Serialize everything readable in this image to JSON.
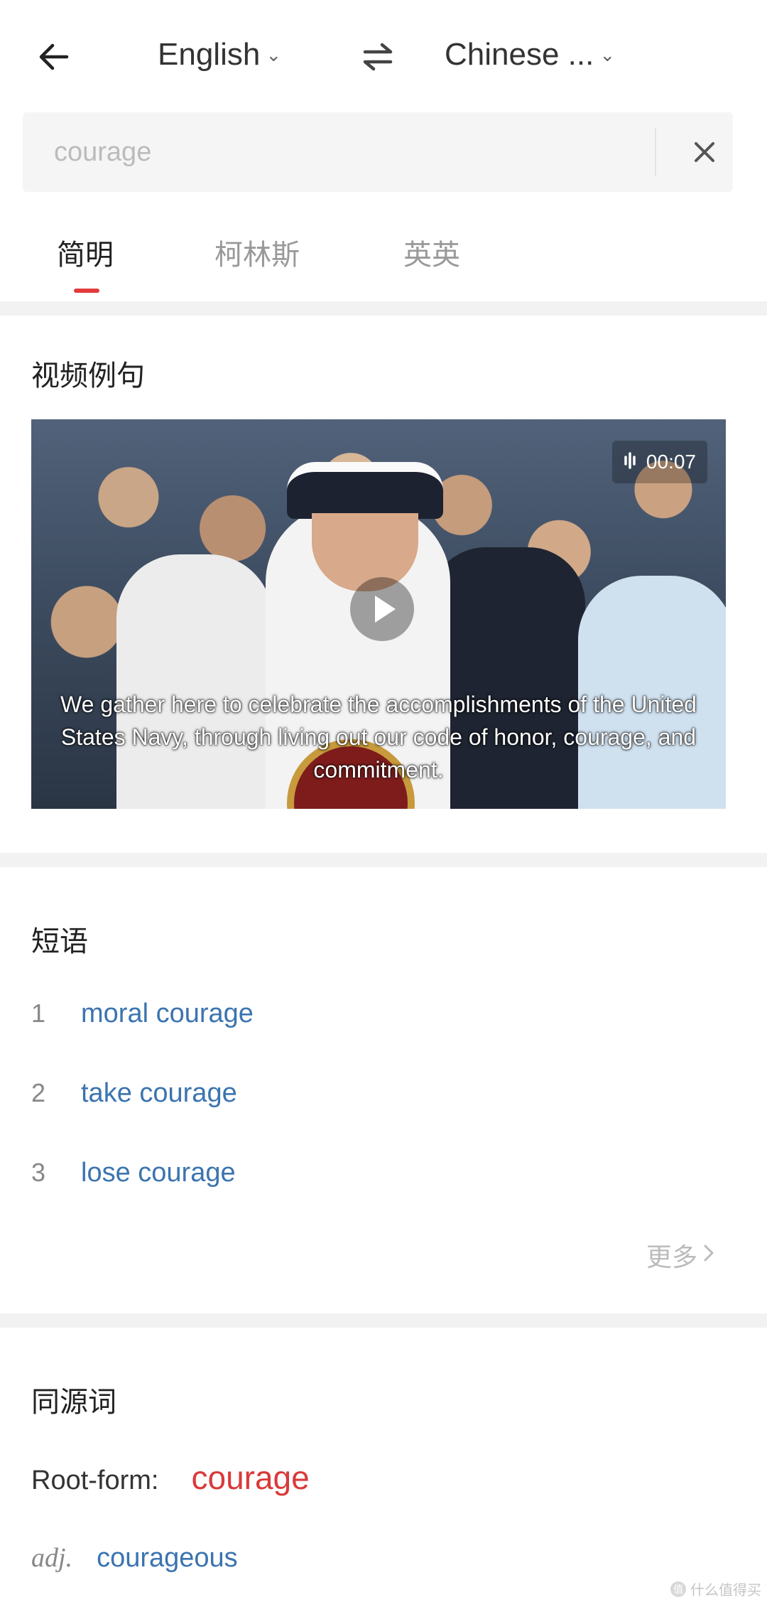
{
  "header": {
    "source_language": "English",
    "target_language": "Chinese ...",
    "colors": {
      "accent": "#e23b3b"
    }
  },
  "search": {
    "value": "courage",
    "clear_icon": "close-icon"
  },
  "tabs": [
    {
      "label": "简明",
      "active": true
    },
    {
      "label": "柯林斯",
      "active": false
    },
    {
      "label": "英英",
      "active": false
    }
  ],
  "video_section": {
    "title": "视频例句",
    "duration": "00:07",
    "subtitle": "We gather here to celebrate the accomplishments of the United States Navy, through living out our code of honor, courage, and commitment."
  },
  "phrases_section": {
    "title": "短语",
    "items": [
      {
        "index": "1",
        "text": "moral courage"
      },
      {
        "index": "2",
        "text": "take courage"
      },
      {
        "index": "3",
        "text": "lose courage"
      }
    ],
    "more_label": "更多"
  },
  "cognates_section": {
    "title": "同源词",
    "root_label": "Root-form:",
    "root_word": "courage",
    "derived": [
      {
        "pos": "adj.",
        "word": "courageous"
      }
    ]
  },
  "watermark": {
    "text": "值 什么值得买",
    "logo": "值"
  }
}
